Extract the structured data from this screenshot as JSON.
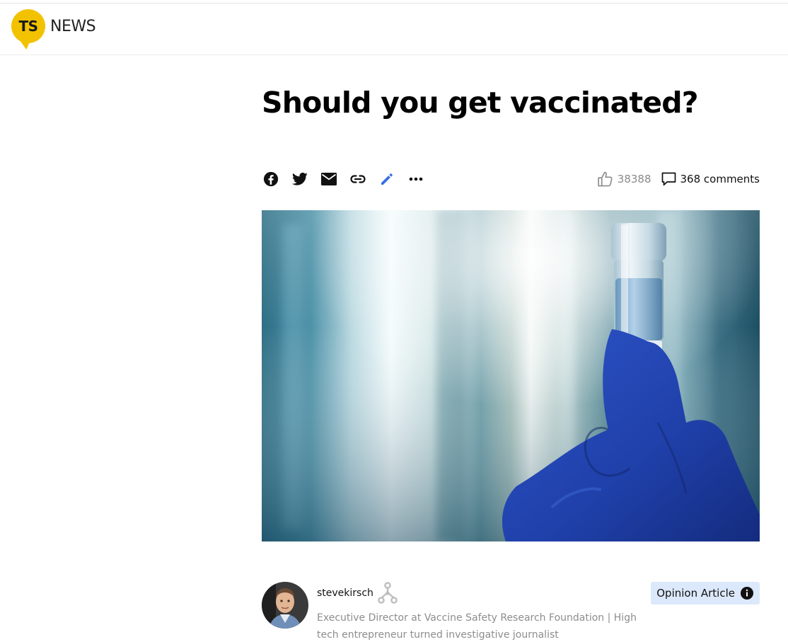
{
  "header": {
    "logo_mark": "TS",
    "logo_word": "NEWS"
  },
  "article": {
    "title": "Should you get vaccinated?",
    "likes": "38388",
    "comments_label": "368 comments"
  },
  "share": {
    "icons": [
      "facebook-icon",
      "twitter-icon",
      "email-icon",
      "link-icon",
      "edit-pencil-icon",
      "more-dots-icon"
    ]
  },
  "author": {
    "name": "stevekirsch",
    "bio": "Executive Director at Vaccine Safety Research Foundation | High tech entrepreneur turned investigative journalist",
    "label": "Opinion Article"
  },
  "colors": {
    "logo_yellow": "#f2c200",
    "edit_accent": "#3b6fe0",
    "opinion_bg": "#dce8fb",
    "glove_blue": "#1f3fa8"
  }
}
